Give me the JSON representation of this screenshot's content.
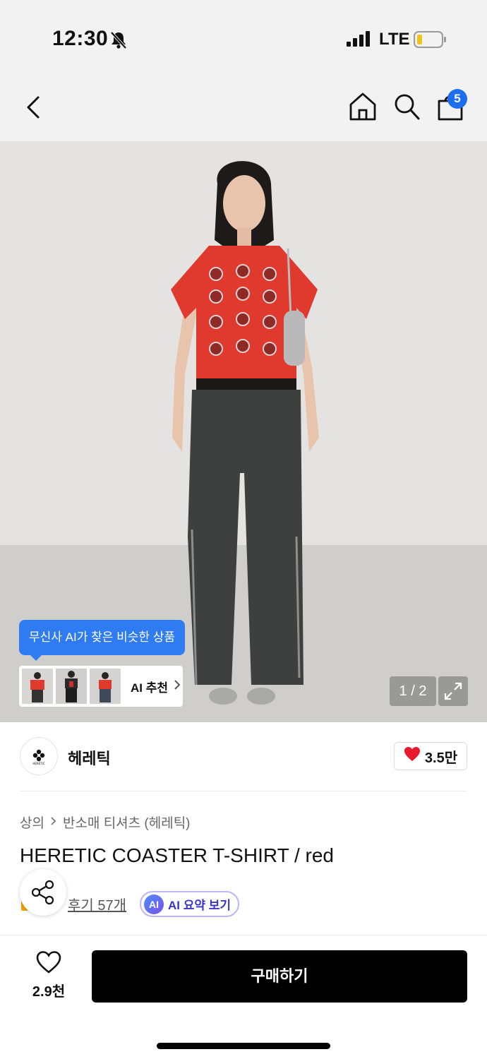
{
  "status": {
    "time": "12:30",
    "network": "LTE",
    "icons": [
      "bell-slash-icon",
      "signal-icon",
      "battery-icon"
    ]
  },
  "nav": {
    "cart_count": "5",
    "icons": [
      "back-icon",
      "home-icon",
      "search-icon",
      "cart-icon"
    ]
  },
  "gallery": {
    "ai_tooltip": "무신사 AI가 찾은 비슷한 상품",
    "ai_reco_label": "AI 추천",
    "pager": "1 / 2"
  },
  "brand": {
    "name": "헤레틱",
    "logo_text": "HERETIC",
    "likes": "3.5만"
  },
  "breadcrumb": {
    "category": "상의",
    "subcategory": "반소매 티셔츠 (헤레틱)"
  },
  "product": {
    "title": "HERETIC COASTER T-SHIRT / red",
    "reviews": "후기 57개",
    "ai_summary_badge": "AI",
    "ai_summary": "AI 요약 보기"
  },
  "bottom": {
    "wish_count": "2.9천",
    "buy_label": "구매하기"
  },
  "colors": {
    "accent_blue": "#1e6ef0",
    "tooltip_blue": "#2f7cf2",
    "heart_red": "#e8192c",
    "shirt_red": "#e0392d",
    "buy_black": "#000000"
  }
}
